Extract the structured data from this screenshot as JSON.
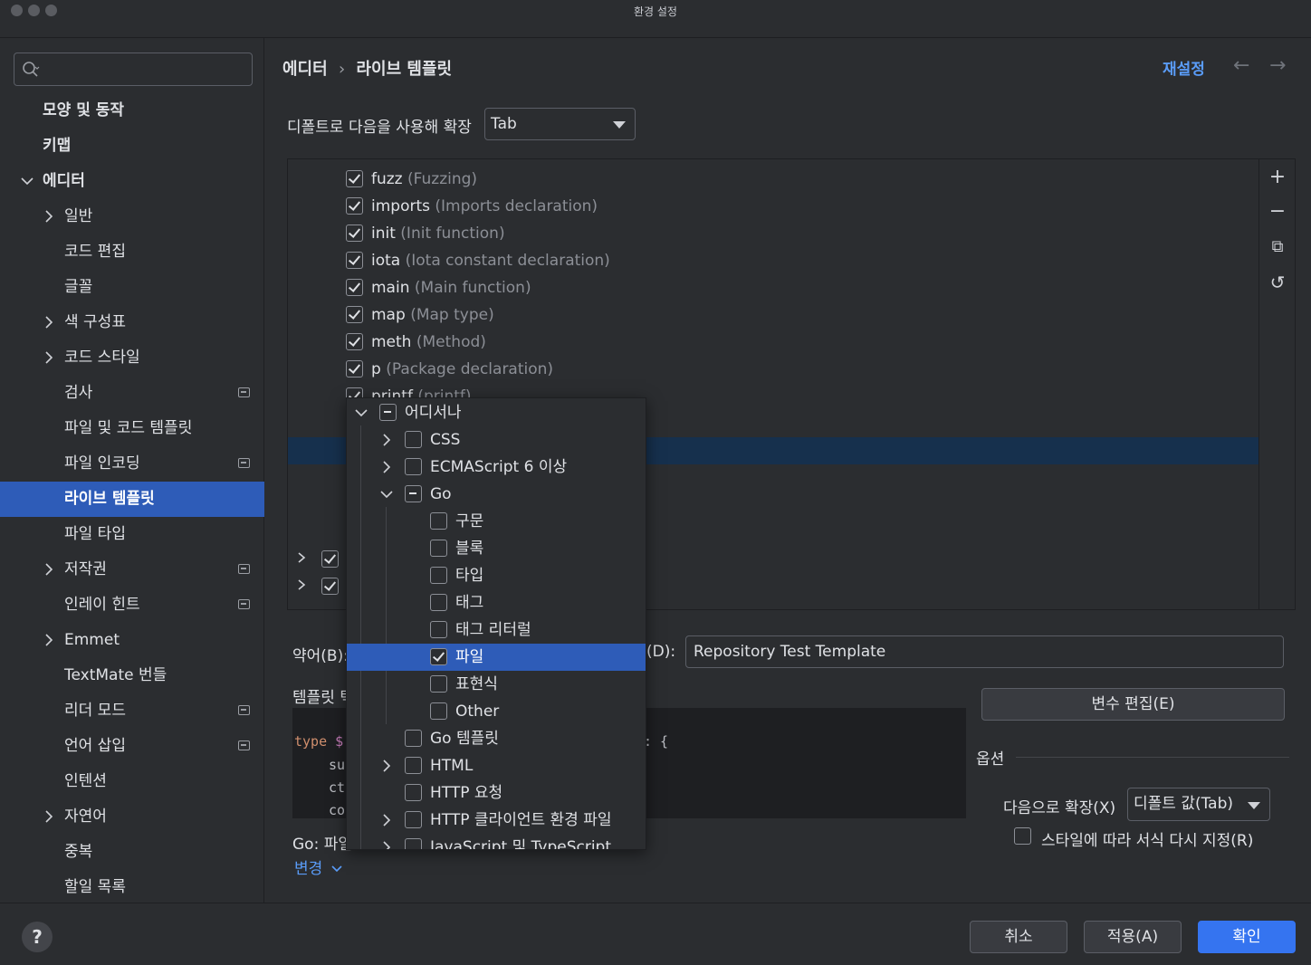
{
  "window": {
    "title": "환경 설정"
  },
  "sidebar": {
    "search_placeholder": "",
    "items": [
      {
        "label": "모양 및 동작",
        "level": 0,
        "bold": true,
        "chevron": "",
        "badge": false
      },
      {
        "label": "키맵",
        "level": 0,
        "bold": true,
        "chevron": "",
        "badge": false
      },
      {
        "label": "에디터",
        "level": 0,
        "bold": true,
        "chevron": "down",
        "badge": false
      },
      {
        "label": "일반",
        "level": 1,
        "chevron": "right",
        "badge": false
      },
      {
        "label": "코드 편집",
        "level": 1,
        "chevron": "",
        "badge": false
      },
      {
        "label": "글꼴",
        "level": 1,
        "chevron": "",
        "badge": false
      },
      {
        "label": "색 구성표",
        "level": 1,
        "chevron": "right",
        "badge": false
      },
      {
        "label": "코드 스타일",
        "level": 1,
        "chevron": "right",
        "badge": false
      },
      {
        "label": "검사",
        "level": 1,
        "chevron": "",
        "badge": true
      },
      {
        "label": "파일 및 코드 템플릿",
        "level": 1,
        "chevron": "",
        "badge": false
      },
      {
        "label": "파일 인코딩",
        "level": 1,
        "chevron": "",
        "badge": true
      },
      {
        "label": "라이브 템플릿",
        "level": 1,
        "chevron": "",
        "badge": false,
        "selected": true
      },
      {
        "label": "파일 타입",
        "level": 1,
        "chevron": "",
        "badge": false
      },
      {
        "label": "저작권",
        "level": 1,
        "chevron": "right",
        "badge": true
      },
      {
        "label": "인레이 힌트",
        "level": 1,
        "chevron": "",
        "badge": true
      },
      {
        "label": "Emmet",
        "level": 1,
        "chevron": "right",
        "badge": false
      },
      {
        "label": "TextMate 번들",
        "level": 1,
        "chevron": "",
        "badge": false
      },
      {
        "label": "리더 모드",
        "level": 1,
        "chevron": "",
        "badge": true
      },
      {
        "label": "언어 삽입",
        "level": 1,
        "chevron": "",
        "badge": true
      },
      {
        "label": "인텐션",
        "level": 1,
        "chevron": "",
        "badge": false
      },
      {
        "label": "자연어",
        "level": 1,
        "chevron": "right",
        "badge": false
      },
      {
        "label": "중복",
        "level": 1,
        "chevron": "",
        "badge": false
      },
      {
        "label": "할일 목록",
        "level": 1,
        "chevron": "",
        "badge": false
      }
    ]
  },
  "header": {
    "breadcrumb": [
      "에디터",
      "라이브 템플릿"
    ],
    "breadcrumb_sep": "›",
    "reset_label": "재설정",
    "back_arrow": "←",
    "forward_arrow": "→"
  },
  "expand": {
    "label": "디폴트로 다음을 사용해 확장",
    "value": "Tab"
  },
  "templates": [
    {
      "name": "fuzz",
      "desc": "(Fuzzing)",
      "checked": true
    },
    {
      "name": "imports",
      "desc": "(Imports declaration)",
      "checked": true
    },
    {
      "name": "init",
      "desc": "(Init function)",
      "checked": true
    },
    {
      "name": "iota",
      "desc": "(Iota constant declaration)",
      "checked": true
    },
    {
      "name": "main",
      "desc": "(Main function)",
      "checked": true
    },
    {
      "name": "map",
      "desc": "(Map type)",
      "checked": true
    },
    {
      "name": "meth",
      "desc": "(Method)",
      "checked": true
    },
    {
      "name": "p",
      "desc": "(Package declaration)",
      "checked": true
    },
    {
      "name": "printf",
      "desc": "(printf)",
      "checked": true
    }
  ],
  "toolbar": {
    "add_icon": "+",
    "remove_icon": "−",
    "copy_icon": "⧉",
    "undo_icon": "↺"
  },
  "form": {
    "abbrev_label": "약어(B):",
    "desc_label": "(D):",
    "desc_value": "Repository Test Template",
    "template_text_label": "템플릿 텍",
    "edit_vars_label": "변수 편집(E)",
    "context_label": "Go: 파일",
    "change_label": "변경",
    "code": {
      "line1_kw": "type",
      "line1_var": "$",
      "line1_tail": ": {",
      "line2": "su",
      "line3": "ct",
      "line4": "co"
    }
  },
  "options": {
    "title": "옵션",
    "expand_with_label": "다음으로 확장(X)",
    "expand_with_value": "디폴트 값(Tab)",
    "reformat_label": "스타일에 따라 서식 다시 지정(R)",
    "reformat_checked": false
  },
  "context_popup": {
    "items": [
      {
        "label": "어디서나",
        "indent": 0,
        "chevron": "down",
        "state": "partial"
      },
      {
        "label": "CSS",
        "indent": 1,
        "chevron": "right",
        "state": "off"
      },
      {
        "label": "ECMAScript 6 이상",
        "indent": 1,
        "chevron": "right",
        "state": "off"
      },
      {
        "label": "Go",
        "indent": 1,
        "chevron": "down",
        "state": "partial"
      },
      {
        "label": "구문",
        "indent": 2,
        "chevron": "",
        "state": "off"
      },
      {
        "label": "블록",
        "indent": 2,
        "chevron": "",
        "state": "off"
      },
      {
        "label": "타입",
        "indent": 2,
        "chevron": "",
        "state": "off"
      },
      {
        "label": "태그",
        "indent": 2,
        "chevron": "",
        "state": "off"
      },
      {
        "label": "태그 리터럴",
        "indent": 2,
        "chevron": "",
        "state": "off"
      },
      {
        "label": "파일",
        "indent": 2,
        "chevron": "",
        "state": "on",
        "selected": true
      },
      {
        "label": "표현식",
        "indent": 2,
        "chevron": "",
        "state": "off"
      },
      {
        "label": "Other",
        "indent": 2,
        "chevron": "",
        "state": "off"
      },
      {
        "label": "Go 템플릿",
        "indent": 1,
        "chevron": "",
        "state": "off"
      },
      {
        "label": "HTML",
        "indent": 1,
        "chevron": "right",
        "state": "off"
      },
      {
        "label": "HTTP 요청",
        "indent": 1,
        "chevron": "",
        "state": "off"
      },
      {
        "label": "HTTP 클라이언트 환경 파일",
        "indent": 1,
        "chevron": "right",
        "state": "off"
      },
      {
        "label": "JavaScript 및 TypeScript",
        "indent": 1,
        "chevron": "right",
        "state": "off"
      }
    ]
  },
  "footer": {
    "help_label": "?",
    "cancel_label": "취소",
    "apply_label": "적용(A)",
    "ok_label": "확인"
  }
}
